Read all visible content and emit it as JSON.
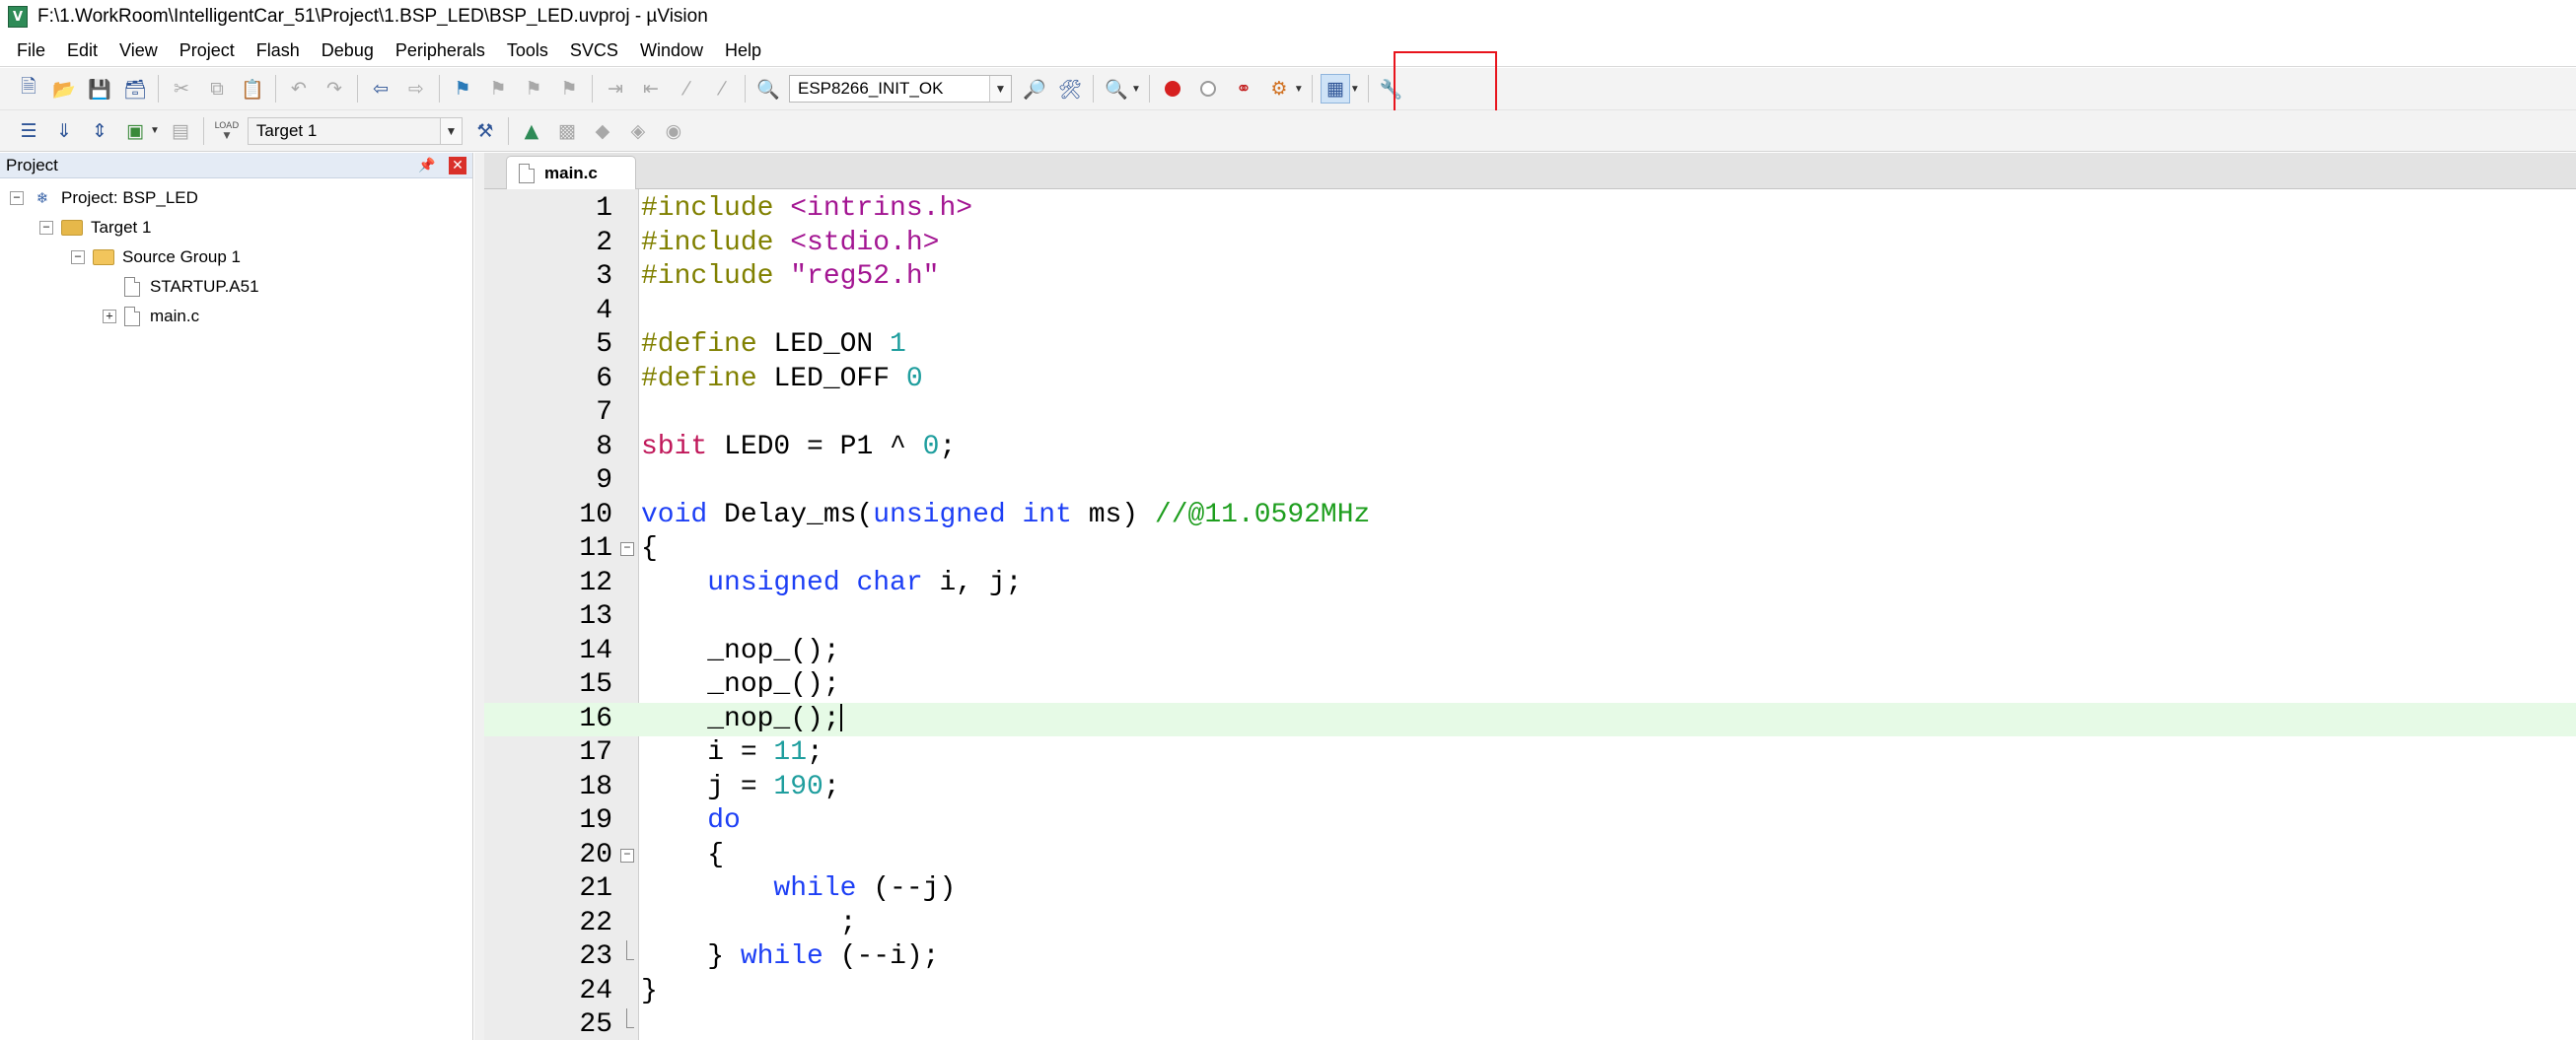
{
  "window": {
    "title": "F:\\1.WorkRoom\\IntelligentCar_51\\Project\\1.BSP_LED\\BSP_LED.uvproj - µVision",
    "logo_text": "V"
  },
  "menu": [
    "File",
    "Edit",
    "View",
    "Project",
    "Flash",
    "Debug",
    "Peripherals",
    "Tools",
    "SVCS",
    "Window",
    "Help"
  ],
  "toolbar": {
    "config_select": "ESP8266_INIT_OK",
    "target_select": "Target 1",
    "load_label": "LOAD",
    "highlight_color": "#e8141c"
  },
  "project_panel": {
    "title": "Project",
    "tree": {
      "project": "Project: BSP_LED",
      "target": "Target 1",
      "group": "Source Group 1",
      "files": [
        "STARTUP.A51",
        "main.c"
      ]
    }
  },
  "editor": {
    "active_tab": "main.c",
    "active_line": 16,
    "lines": [
      {
        "n": "1",
        "tokens": [
          [
            "pre",
            "#include "
          ],
          [
            "str",
            "<intrins.h>"
          ]
        ]
      },
      {
        "n": "2",
        "tokens": [
          [
            "pre",
            "#include "
          ],
          [
            "str",
            "<stdio.h>"
          ]
        ]
      },
      {
        "n": "3",
        "tokens": [
          [
            "pre",
            "#include "
          ],
          [
            "str",
            "\"reg52.h\""
          ]
        ]
      },
      {
        "n": "4",
        "tokens": []
      },
      {
        "n": "5",
        "tokens": [
          [
            "pre",
            "#define "
          ],
          [
            "plain",
            "LED_ON "
          ],
          [
            "num",
            "1"
          ]
        ]
      },
      {
        "n": "6",
        "tokens": [
          [
            "pre",
            "#define "
          ],
          [
            "plain",
            "LED_OFF "
          ],
          [
            "num",
            "0"
          ]
        ]
      },
      {
        "n": "7",
        "tokens": []
      },
      {
        "n": "8",
        "tokens": [
          [
            "sbit",
            "sbit "
          ],
          [
            "plain",
            "LED0 = P1 ^ "
          ],
          [
            "num",
            "0"
          ],
          [
            "plain",
            ";"
          ]
        ]
      },
      {
        "n": "9",
        "tokens": []
      },
      {
        "n": "10",
        "tokens": [
          [
            "kw",
            "void "
          ],
          [
            "plain",
            "Delay_ms("
          ],
          [
            "kw",
            "unsigned int "
          ],
          [
            "plain",
            "ms) "
          ],
          [
            "cmt",
            "//@11.0592MHz"
          ]
        ]
      },
      {
        "n": "11",
        "tokens": [
          [
            "plain",
            "{"
          ]
        ]
      },
      {
        "n": "12",
        "tokens": [
          [
            "plain",
            "    "
          ],
          [
            "kw",
            "unsigned char "
          ],
          [
            "plain",
            "i, j;"
          ]
        ]
      },
      {
        "n": "13",
        "tokens": []
      },
      {
        "n": "14",
        "tokens": [
          [
            "plain",
            "    _nop_();"
          ]
        ]
      },
      {
        "n": "15",
        "tokens": [
          [
            "plain",
            "    _nop_();"
          ]
        ]
      },
      {
        "n": "16",
        "tokens": [
          [
            "plain",
            "    _nop_();"
          ]
        ]
      },
      {
        "n": "17",
        "tokens": [
          [
            "plain",
            "    i = "
          ],
          [
            "num",
            "11"
          ],
          [
            "plain",
            ";"
          ]
        ]
      },
      {
        "n": "18",
        "tokens": [
          [
            "plain",
            "    j = "
          ],
          [
            "num",
            "190"
          ],
          [
            "plain",
            ";"
          ]
        ]
      },
      {
        "n": "19",
        "tokens": [
          [
            "plain",
            "    "
          ],
          [
            "kw",
            "do"
          ]
        ]
      },
      {
        "n": "20",
        "tokens": [
          [
            "plain",
            "    {"
          ]
        ]
      },
      {
        "n": "21",
        "tokens": [
          [
            "plain",
            "        "
          ],
          [
            "kw",
            "while "
          ],
          [
            "plain",
            "(--j)"
          ]
        ]
      },
      {
        "n": "22",
        "tokens": [
          [
            "plain",
            "            ;"
          ]
        ]
      },
      {
        "n": "23",
        "tokens": [
          [
            "plain",
            "    } "
          ],
          [
            "kw",
            "while "
          ],
          [
            "plain",
            "(--i);"
          ]
        ]
      },
      {
        "n": "24",
        "tokens": [
          [
            "plain",
            "}"
          ]
        ]
      },
      {
        "n": "25",
        "tokens": []
      }
    ]
  }
}
